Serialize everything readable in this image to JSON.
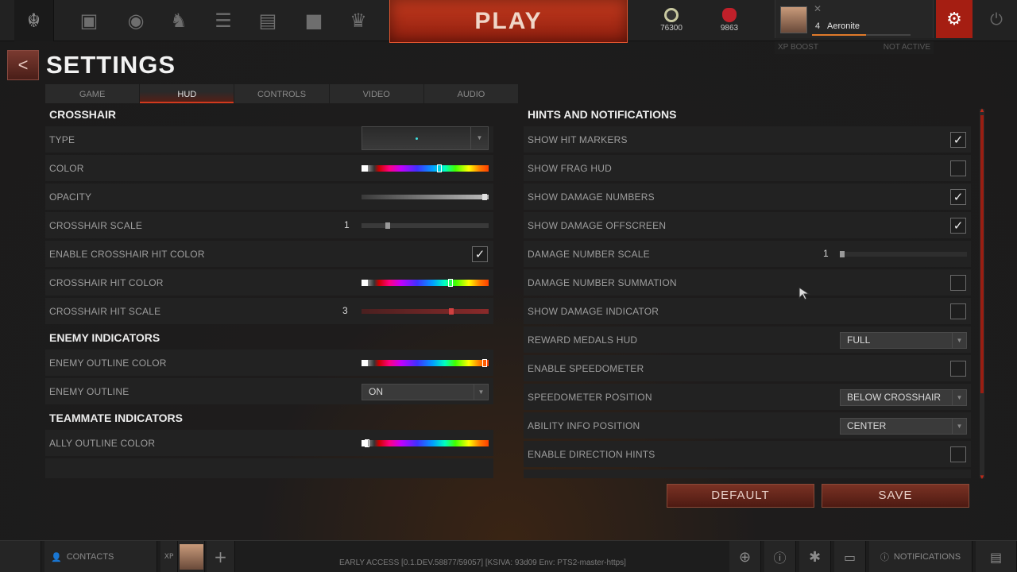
{
  "topbar": {
    "play_label": "PLAY",
    "currency_1": "76300",
    "currency_2": "9863",
    "profile_level": "4",
    "profile_name": "Aeronite",
    "xp_boost_label": "XP BOOST",
    "xp_boost_status": "NOT ACTIVE"
  },
  "header": {
    "back_glyph": "<",
    "title": "SETTINGS"
  },
  "tabs": [
    "GAME",
    "HUD",
    "CONTROLS",
    "VIDEO",
    "AUDIO"
  ],
  "left": {
    "crosshair_h": "CROSSHAIR",
    "type_label": "TYPE",
    "color_label": "COLOR",
    "opacity_label": "OPACITY",
    "scale_label": "CROSSHAIR SCALE",
    "scale_value": "1",
    "enable_hit_label": "ENABLE CROSSHAIR HIT COLOR",
    "hit_color_label": "CROSSHAIR HIT COLOR",
    "hit_scale_label": "CROSSHAIR HIT SCALE",
    "hit_scale_value": "3",
    "enemy_h": "ENEMY INDICATORS",
    "enemy_outline_color_label": "ENEMY OUTLINE COLOR",
    "enemy_outline_label": "ENEMY OUTLINE",
    "enemy_outline_value": "ON",
    "teammate_h": "TEAMMATE INDICATORS",
    "ally_outline_color_label": "ALLY OUTLINE COLOR"
  },
  "right": {
    "hints_h": "HINTS AND NOTIFICATIONS",
    "show_hit_markers": "SHOW HIT MARKERS",
    "show_frag_hud": "SHOW FRAG HUD",
    "show_damage_numbers": "SHOW DAMAGE NUMBERS",
    "show_damage_offscreen": "SHOW DAMAGE OFFSCREEN",
    "damage_number_scale": "DAMAGE NUMBER SCALE",
    "damage_number_scale_value": "1",
    "damage_number_summation": "DAMAGE NUMBER SUMMATION",
    "show_damage_indicator": "SHOW DAMAGE INDICATOR",
    "reward_medals_hud": "REWARD MEDALS HUD",
    "reward_medals_value": "FULL",
    "enable_speedometer": "ENABLE SPEEDOMETER",
    "speedometer_position": "SPEEDOMETER POSITION",
    "speedometer_position_value": "BELOW CROSSHAIR",
    "ability_info_position": "ABILITY INFO POSITION",
    "ability_info_value": "CENTER",
    "enable_direction_hints": "ENABLE DIRECTION HINTS"
  },
  "checks": {
    "enable_hit_color": true,
    "show_hit_markers": true,
    "show_frag_hud": false,
    "show_damage_numbers": true,
    "show_damage_offscreen": true,
    "damage_number_summation": false,
    "show_damage_indicator": false,
    "enable_speedometer": false,
    "enable_direction_hints": false
  },
  "check_glyph": "✓",
  "dropdown_arrow": "▼",
  "buttons": {
    "default": "DEFAULT",
    "save": "SAVE"
  },
  "bottombar": {
    "contacts": "CONTACTS",
    "version": "EARLY ACCESS [0.1.DEV.58877/59057] [KSIVA: 93d09 Env: PTS2-master-https]",
    "notifications": "NOTIFICATIONS",
    "xp_label": "XP"
  },
  "icons": {
    "nav": [
      "quake-logo-icon",
      "book-icon",
      "shield-ring-icon",
      "champion-icon",
      "checklist-icon",
      "scroll-icon",
      "camera-icon",
      "trophy-icon"
    ],
    "currency_1_icon": "favor-coin-icon",
    "currency_2_icon": "shard-icon"
  },
  "colors": {
    "accent": "#d23a1e",
    "play": "#c43a1e",
    "currency_1": "#c8c8a0",
    "currency_2": "#c0202a"
  }
}
